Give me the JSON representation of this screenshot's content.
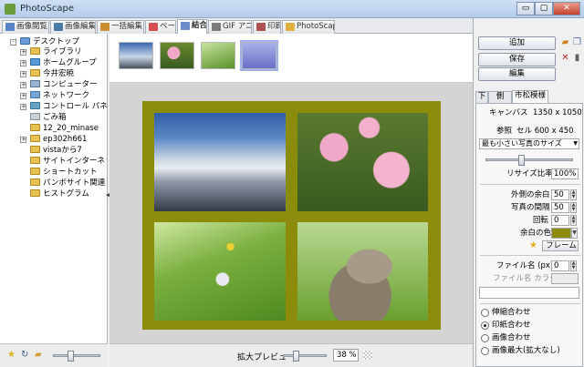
{
  "window": {
    "title": "PhotoScape",
    "buttons": [
      "▭",
      "▢",
      "✕"
    ]
  },
  "tabs": [
    {
      "label": "画像閲覧",
      "color": "#5a84c8"
    },
    {
      "label": "画像編集",
      "color": "#4a7aa8"
    },
    {
      "label": "一括編集",
      "color": "#c89030"
    },
    {
      "label": "ページ",
      "color": "#d05050"
    },
    {
      "label": "結合",
      "color": "#6a8ac8",
      "active": true
    },
    {
      "label": "GIF アニメ",
      "color": "#7a7a7a"
    },
    {
      "label": "印刷",
      "color": "#b05050"
    },
    {
      "label": "PhotoScape",
      "color": "#e0b040"
    }
  ],
  "tree": [
    {
      "label": "デスクトップ",
      "expander": "-"
    },
    {
      "label": "ライブラリ",
      "expander": "+"
    },
    {
      "label": "ホームグループ",
      "expander": "+"
    },
    {
      "label": "今井宏暁",
      "expander": "+"
    },
    {
      "label": "コンピューター",
      "expander": "+"
    },
    {
      "label": "ネットワーク",
      "expander": "+"
    },
    {
      "label": "コントロール パネル",
      "expander": "+"
    },
    {
      "label": "ごみ箱",
      "expander": ""
    },
    {
      "label": "12_20_minase",
      "expander": ""
    },
    {
      "label": "ep302h661",
      "expander": "+"
    },
    {
      "label": "vistaから7",
      "expander": ""
    },
    {
      "label": "サイトインターネット",
      "expander": ""
    },
    {
      "label": "ショートカット",
      "expander": ""
    },
    {
      "label": "パンボサイト関連",
      "expander": ""
    },
    {
      "label": "ヒストグラム",
      "expander": ""
    }
  ],
  "thumbnails": [
    "sky",
    "flowers",
    "grass",
    "selected"
  ],
  "zoom": {
    "label": "拡大プレビュー",
    "value": "38 %"
  },
  "right": {
    "add": "追加",
    "save": "保存",
    "edit": "編集",
    "subtabs": [
      "下",
      "側",
      "市松模様"
    ],
    "canvas_label": "キャンバス",
    "canvas_value": "1350 x 1050",
    "ref_label": "参照",
    "ref_value": "セル 600 x 450",
    "size_combo": "最も小さい写真のサイズ",
    "resize_label": "リサイズ比率",
    "resize_value": "100%",
    "outer_margin_label": "外側の余白",
    "outer_margin_value": "50",
    "photo_gap_label": "写真の間隔",
    "photo_gap_value": "50",
    "rotate_label": "回転",
    "rotate_value": "0",
    "margin_color_label": "余白の色",
    "margin_color": "#8c8c0c",
    "frame_button": "フレーム",
    "filename_label": "ファイル名 (px)",
    "filename_value": "0",
    "filename_color_label": "ファイル名 カラー",
    "radios": [
      {
        "label": "伸縮合わせ",
        "checked": false
      },
      {
        "label": "印紙合わせ",
        "checked": true
      },
      {
        "label": "画像合わせ",
        "checked": false
      },
      {
        "label": "画像最大(拡大なし)",
        "checked": false
      }
    ]
  }
}
